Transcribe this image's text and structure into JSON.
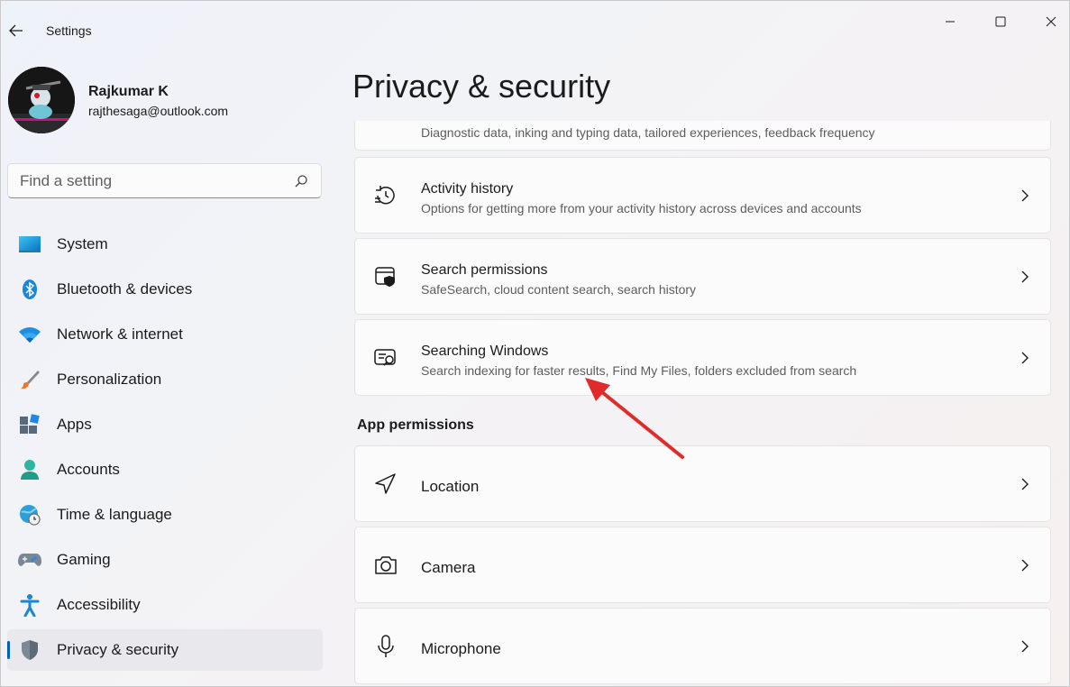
{
  "titlebar": {
    "app_title": "Settings"
  },
  "profile": {
    "name": "Rajkumar K",
    "email": "rajthesaga@outlook.com"
  },
  "search": {
    "placeholder": "Find a setting"
  },
  "nav": {
    "items": [
      {
        "label": "System",
        "icon": "system-icon"
      },
      {
        "label": "Bluetooth & devices",
        "icon": "bluetooth-icon"
      },
      {
        "label": "Network & internet",
        "icon": "wifi-icon"
      },
      {
        "label": "Personalization",
        "icon": "brush-icon"
      },
      {
        "label": "Apps",
        "icon": "apps-icon"
      },
      {
        "label": "Accounts",
        "icon": "accounts-icon"
      },
      {
        "label": "Time & language",
        "icon": "globe-clock-icon"
      },
      {
        "label": "Gaming",
        "icon": "gamepad-icon"
      },
      {
        "label": "Accessibility",
        "icon": "accessibility-icon"
      },
      {
        "label": "Privacy & security",
        "icon": "shield-icon",
        "active": true
      }
    ]
  },
  "main": {
    "page_title": "Privacy & security",
    "cards": [
      {
        "title": "",
        "subtitle": "Diagnostic data, inking and typing data, tailored experiences, feedback frequency",
        "icon": "diagnostics-icon"
      },
      {
        "title": "Activity history",
        "subtitle": "Options for getting more from your activity history across devices and accounts",
        "icon": "history-icon"
      },
      {
        "title": "Search permissions",
        "subtitle": "SafeSearch, cloud content search, search history",
        "icon": "search-permissions-icon"
      },
      {
        "title": "Searching Windows",
        "subtitle": "Search indexing for faster results, Find My Files, folders excluded from search",
        "icon": "searching-windows-icon"
      }
    ],
    "section_header": "App permissions",
    "app_permissions": [
      {
        "title": "Location",
        "icon": "location-icon"
      },
      {
        "title": "Camera",
        "icon": "camera-icon"
      },
      {
        "title": "Microphone",
        "icon": "microphone-icon"
      }
    ]
  },
  "colors": {
    "accent": "#005fb8",
    "annotation_arrow": "#e02b2b"
  }
}
